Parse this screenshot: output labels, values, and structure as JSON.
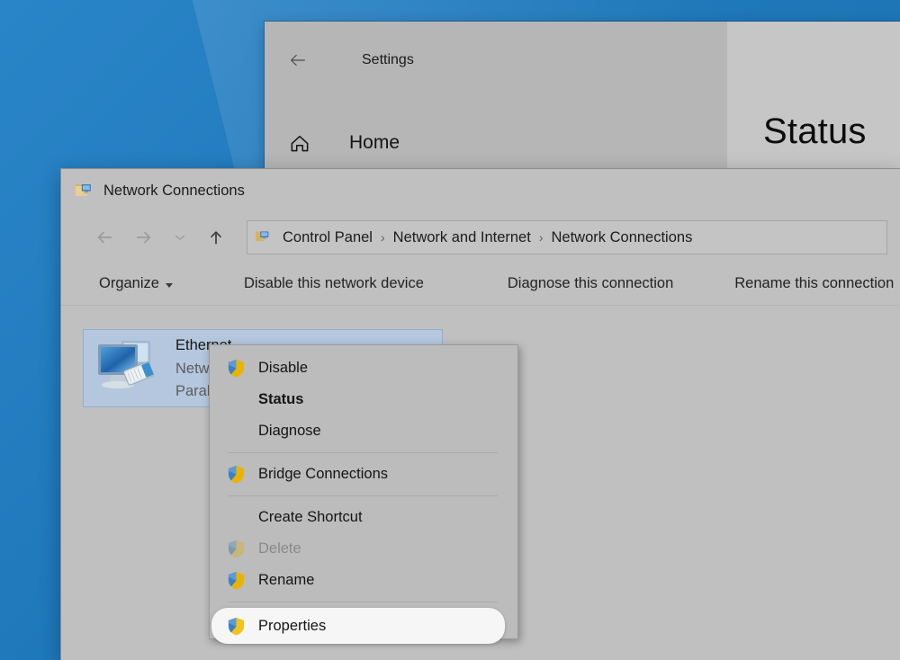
{
  "desktop": {
    "background_color": "#1f78ba"
  },
  "settings_window": {
    "app_title": "Settings",
    "back_icon": "back-arrow-icon",
    "home_icon": "home-icon",
    "home_label": "Home",
    "page_title": "Status"
  },
  "explorer_window": {
    "title": "Network Connections",
    "title_icon": "network-connections-folder-icon",
    "nav": {
      "back_icon": "back-arrow-icon",
      "forward_icon": "forward-arrow-icon",
      "recent_icon": "chevron-down-icon",
      "up_icon": "up-arrow-icon",
      "back_enabled": "false",
      "forward_enabled": "false",
      "recent_enabled": "false",
      "up_enabled": "true"
    },
    "breadcrumb": {
      "icon": "network-connections-icon",
      "separator": "›",
      "items": [
        {
          "label": "Control Panel"
        },
        {
          "label": "Network and Internet"
        },
        {
          "label": "Network Connections"
        }
      ]
    },
    "toolbar": {
      "items": [
        {
          "label": "Organize",
          "has_caret": "true"
        },
        {
          "label": "Disable this network device",
          "has_caret": "false"
        },
        {
          "label": "Diagnose this connection",
          "has_caret": "false"
        },
        {
          "label": "Rename this connection",
          "has_caret": "false"
        }
      ]
    },
    "connection": {
      "icon": "network-adapter-icon",
      "name": "Ethernet",
      "line2": "Network",
      "line3": "Parallels",
      "selected": "true"
    }
  },
  "context_menu": {
    "items": [
      {
        "label": "Disable",
        "icon": "uac-shield-icon",
        "has_shield": "true",
        "bold": "false",
        "disabled": "false",
        "highlighted": "false"
      },
      {
        "label": "Status",
        "icon": "",
        "has_shield": "false",
        "bold": "true",
        "disabled": "false",
        "highlighted": "false"
      },
      {
        "label": "Diagnose",
        "icon": "",
        "has_shield": "false",
        "bold": "false",
        "disabled": "false",
        "highlighted": "false"
      },
      {
        "separator": "true"
      },
      {
        "label": "Bridge Connections",
        "icon": "uac-shield-icon",
        "has_shield": "true",
        "bold": "false",
        "disabled": "false",
        "highlighted": "false"
      },
      {
        "separator": "true"
      },
      {
        "label": "Create Shortcut",
        "icon": "",
        "has_shield": "false",
        "bold": "false",
        "disabled": "false",
        "highlighted": "false"
      },
      {
        "label": "Delete",
        "icon": "uac-shield-icon",
        "has_shield": "true",
        "bold": "false",
        "disabled": "true",
        "highlighted": "false"
      },
      {
        "label": "Rename",
        "icon": "uac-shield-icon",
        "has_shield": "true",
        "bold": "false",
        "disabled": "false",
        "highlighted": "false"
      },
      {
        "separator": "true"
      },
      {
        "label": "Properties",
        "icon": "uac-shield-icon",
        "has_shield": "true",
        "bold": "false",
        "disabled": "false",
        "highlighted": "true"
      }
    ]
  },
  "colors": {
    "desktop_blue": "#1f78ba",
    "window_gray": "#c0c0c0",
    "menu_gray": "#bcbcbc",
    "selection_blue": "#b4c7de",
    "highlight_white": "#f6f6f6",
    "shield_blue": "#2e6fbf",
    "shield_gold": "#f0c419"
  }
}
